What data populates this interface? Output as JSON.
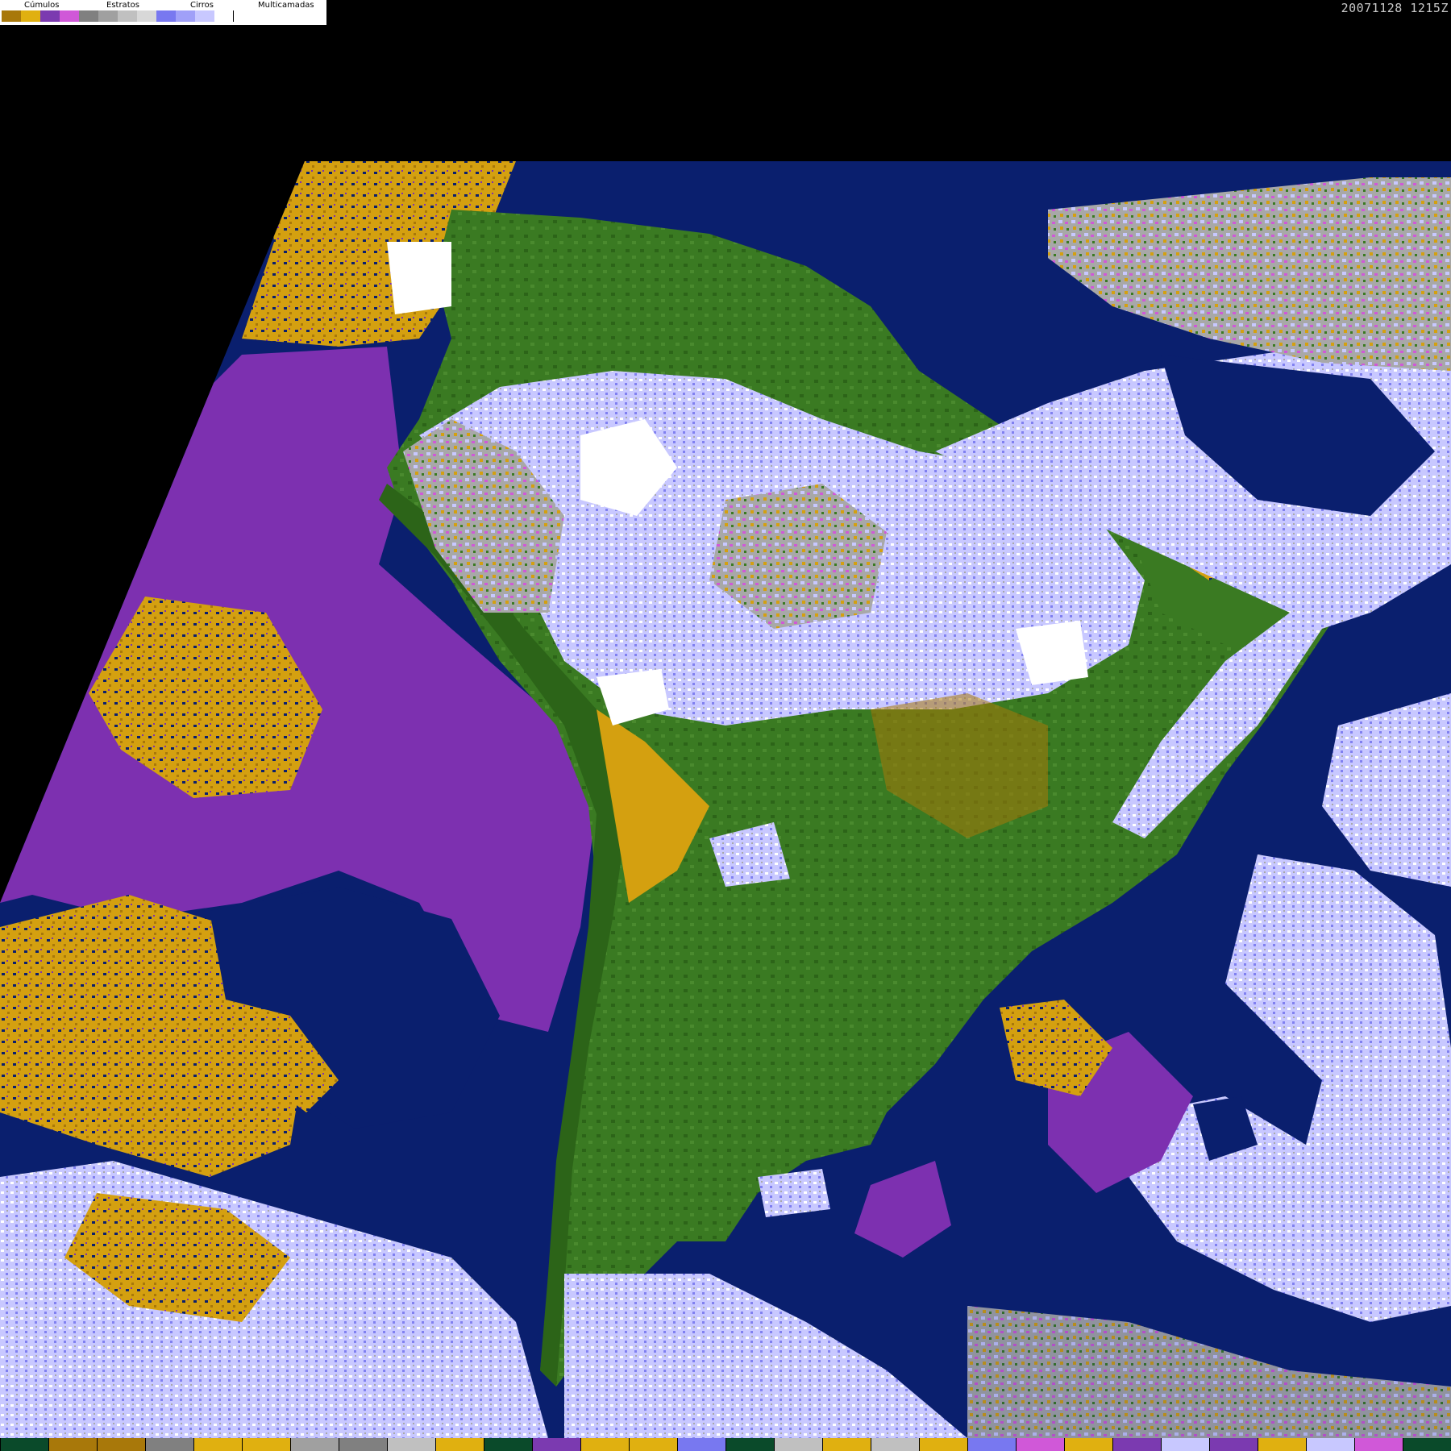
{
  "legend": {
    "labels": [
      "Cúmulos",
      "Estratos",
      "Cirros",
      "Multicamadas"
    ],
    "swatches": [
      "#a8780a",
      "#e0b010",
      "#7b3ab0",
      "#d058d8",
      "#808080",
      "#a0a0a0",
      "#c0c0c0",
      "#d8d8d8",
      "#7878f0",
      "#a0a0f8",
      "#c8c8ff",
      "#ffffff"
    ]
  },
  "timestamp": "20071128 1215Z",
  "colors": {
    "ocean": "#0a1f6e",
    "land": "#3a7a22",
    "land_dark": "#1f5a12",
    "stratus": "#7d30b0",
    "cumulus_gold": "#d4a010",
    "cumulus_brown": "#a8780a",
    "multilayer_light": "#c8c8ff",
    "multilayer_blue": "#8080f0",
    "cirrus_grey": "#a8a8a8",
    "white": "#ffffff"
  },
  "bottom_bar": [
    "#0a4a2a",
    "#a8780a",
    "#a8780a",
    "#808080",
    "#e0b010",
    "#e0b010",
    "#a0a0a0",
    "#808080",
    "#c0c0c0",
    "#e0b010",
    "#0a4a2a",
    "#7b3ab0",
    "#e0b010",
    "#e0b010",
    "#7878f0",
    "#0a4a2a",
    "#c0c0c0",
    "#e0b010",
    "#c0c0c0",
    "#e0b010",
    "#7878f0",
    "#d058d8",
    "#e0b010",
    "#7b3ab0",
    "#c8c8ff",
    "#7b3ab0",
    "#e0b010",
    "#c8c8ff",
    "#d058d8",
    "#0a4a2a"
  ]
}
